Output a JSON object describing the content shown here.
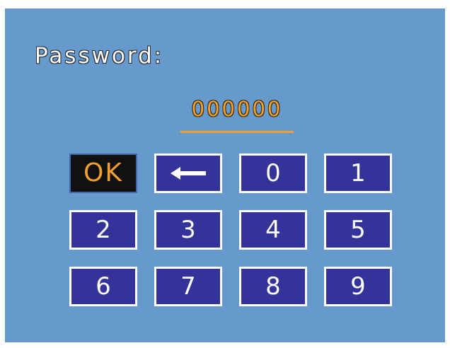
{
  "dialog": {
    "title": "Password:",
    "password_value": "000000"
  },
  "keypad": {
    "ok_label": "OK",
    "backspace_icon": "left-arrow-icon",
    "digits": [
      "0",
      "1",
      "2",
      "3",
      "4",
      "5",
      "6",
      "7",
      "8",
      "9"
    ]
  },
  "colors": {
    "background": "#6699cc",
    "key_fill": "#333399",
    "key_border": "#ffffff",
    "accent": "#f0a030",
    "selected_fill": "#111111"
  }
}
